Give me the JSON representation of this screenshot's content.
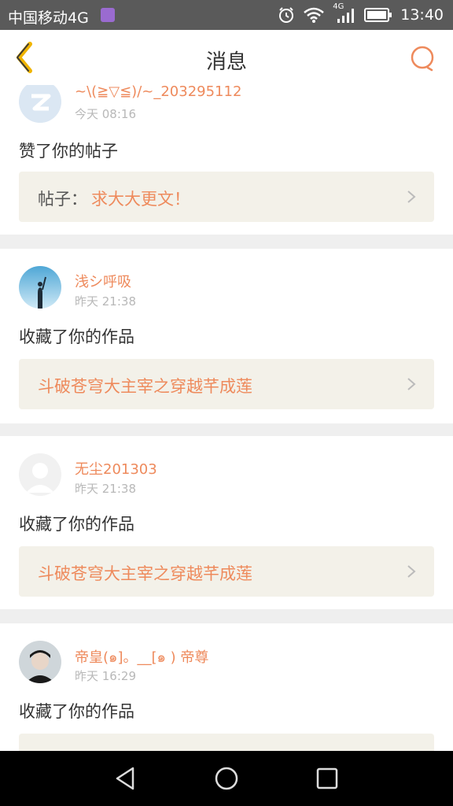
{
  "status_bar": {
    "carrier": "中国移动4G",
    "network_label": "4G",
    "time": "13:40"
  },
  "header": {
    "title": "消息"
  },
  "colors": {
    "accent": "#ee8a5c",
    "back_arrow": "#f0b400",
    "ref_bg": "#f3f1e9"
  },
  "messages": [
    {
      "username": "~\\(≧▽≦)/~_203295112",
      "time": "今天 08:16",
      "action": "赞了你的帖子",
      "ref_label": "帖子：",
      "ref_value": "求大大更文！",
      "avatar": "qq-default-avatar"
    },
    {
      "username": "浅シ呼吸",
      "time": "昨天 21:38",
      "action": "收藏了你的作品",
      "ref_label": "",
      "ref_value": "斗破苍穹大主宰之穿越芊成莲",
      "avatar": "photo-avatar"
    },
    {
      "username": "无尘201303",
      "time": "昨天 21:38",
      "action": "收藏了你的作品",
      "ref_label": "",
      "ref_value": "斗破苍穹大主宰之穿越芊成莲",
      "avatar": "blank-avatar"
    },
    {
      "username": "帝皇(๑]。__[๑ ) 帝尊",
      "time": "昨天 16:29",
      "action": "收藏了你的作品",
      "ref_label": "",
      "ref_value": "",
      "avatar": "photo-avatar"
    }
  ],
  "nav_bar": {
    "icons": [
      "back-triangle-icon",
      "home-circle-icon",
      "recents-square-icon"
    ]
  }
}
